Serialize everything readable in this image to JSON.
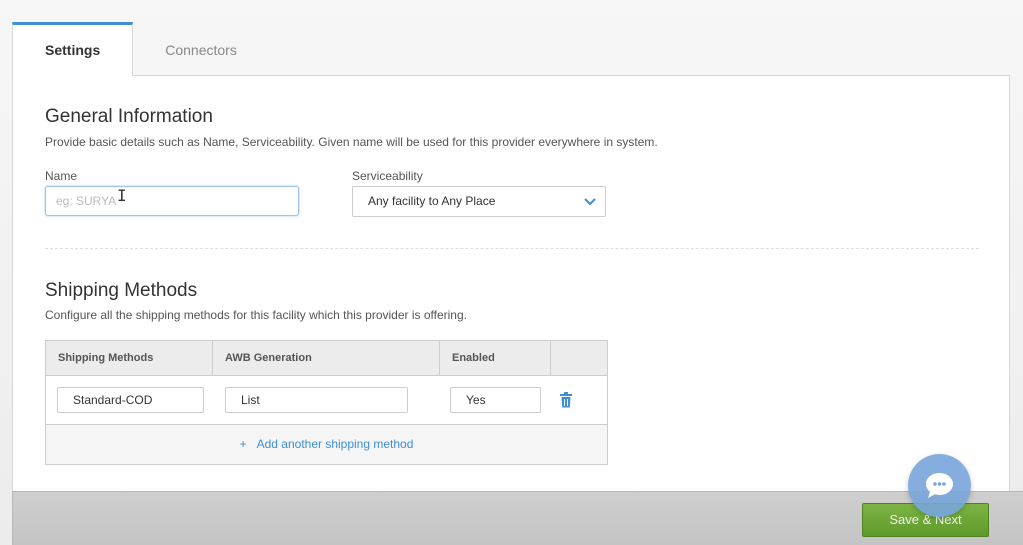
{
  "tabs": [
    {
      "label": "Settings",
      "active": true
    },
    {
      "label": "Connectors",
      "active": false
    }
  ],
  "general": {
    "title": "General Information",
    "description": "Provide basic details such as Name, Serviceability. Given name will be used for this provider everywhere in system.",
    "name_label": "Name",
    "name_placeholder": "eg: SURYA",
    "name_value": "",
    "serviceability_label": "Serviceability",
    "serviceability_value": "Any facility to Any Place"
  },
  "shipping": {
    "title": "Shipping Methods",
    "description": "Configure all the shipping methods for this facility which this provider is offering.",
    "columns": [
      "Shipping Methods",
      "AWB Generation",
      "Enabled",
      ""
    ],
    "rows": [
      {
        "method": "Standard-COD",
        "awb": "List",
        "enabled": "Yes"
      }
    ],
    "add_label": "Add another shipping method",
    "add_icon": "+"
  },
  "footer": {
    "save_label": "Save & Next"
  },
  "colors": {
    "accent": "#3d8fd6",
    "save_green": "#6aa634",
    "chat_blue": "#78a5dc"
  },
  "icons": {
    "chevron": "chevron-down-icon",
    "trash": "trash-icon",
    "chat": "chat-bubble-icon",
    "cursor": "text-cursor-icon"
  }
}
